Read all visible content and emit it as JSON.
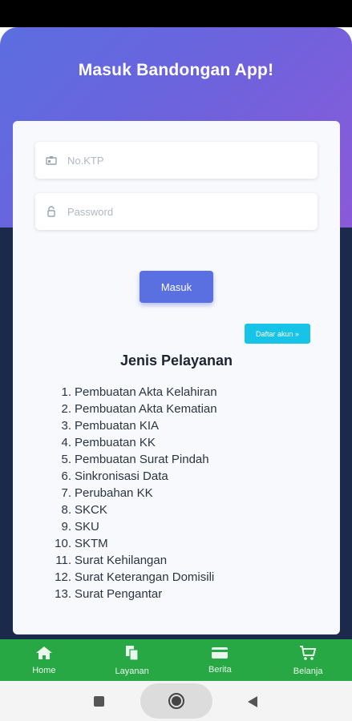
{
  "header": {
    "title": "Masuk Bandongan App!"
  },
  "form": {
    "ktp_placeholder": "No.KTP",
    "password_placeholder": "Password",
    "login_label": "Masuk",
    "register_label": "Daftar akun »"
  },
  "services": {
    "title": "Jenis Pelayanan",
    "items": [
      "Pembuatan Akta Kelahiran",
      "Pembuatan Akta Kematian",
      "Pembuatan KIA",
      "Pembuatan KK",
      "Pembuatan Surat Pindah",
      "Sinkronisasi Data",
      "Perubahan KK",
      "SKCK",
      "SKU",
      "SKTM",
      "Surat Kehilangan",
      "Surat Keterangan Domisili",
      "Surat Pengantar"
    ]
  },
  "bottom_nav": [
    {
      "label": "Home",
      "icon": "home-icon"
    },
    {
      "label": "Layanan",
      "icon": "documents-icon"
    },
    {
      "label": "Berita",
      "icon": "card-icon"
    },
    {
      "label": "Belanja",
      "icon": "cart-icon"
    }
  ],
  "colors": {
    "gradient_start": "#5b6ee0",
    "gradient_end": "#8a5ad9",
    "navy": "#1b2a4a",
    "primary_button": "#5a6fe0",
    "register_button": "#17c3e6",
    "bottom_nav": "#28a745"
  }
}
